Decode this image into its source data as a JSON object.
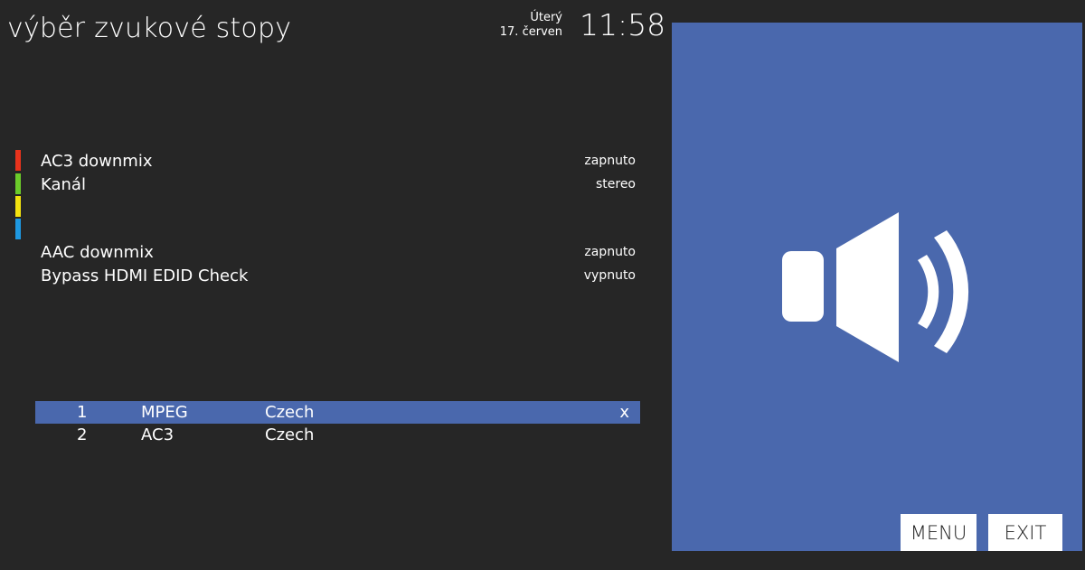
{
  "header": {
    "title": "výběr zvukové stopy",
    "day": "Úterý",
    "date": "17. červen",
    "time": "11:58"
  },
  "color_keys": {
    "red": "#e8331c",
    "green": "#6ccb2a",
    "yellow": "#f2e20f",
    "blue": "#1e98e0"
  },
  "options": [
    {
      "label": "AC3 downmix",
      "value": "zapnuto"
    },
    {
      "label": "Kanál",
      "value": "stereo"
    },
    {
      "label": "AAC downmix",
      "value": "zapnuto"
    },
    {
      "label": "Bypass HDMI EDID Check",
      "value": "vypnuto"
    }
  ],
  "tracks": [
    {
      "num": "1",
      "codec": "MPEG",
      "lang": "Czech",
      "mark": "x"
    },
    {
      "num": "2",
      "codec": "AC3",
      "lang": "Czech",
      "mark": ""
    }
  ],
  "preview": {
    "icon": "speaker-icon",
    "background": "#4a68ad"
  },
  "buttons": {
    "menu": "MENU",
    "exit": "EXIT"
  }
}
